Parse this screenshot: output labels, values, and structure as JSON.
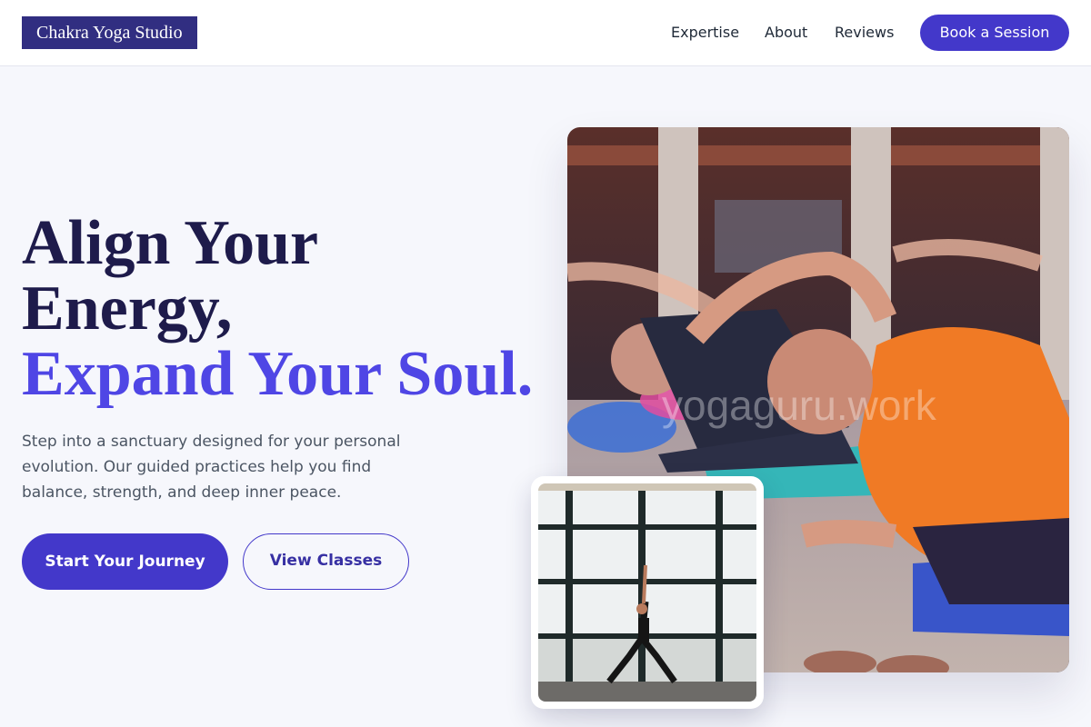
{
  "brand": {
    "name": "Chakra Yoga Studio"
  },
  "nav": {
    "links": [
      "Expertise",
      "About",
      "Reviews"
    ],
    "cta": "Book a Session"
  },
  "hero": {
    "headline_line1": "Align Your",
    "headline_line2": "Energy,",
    "headline_accent": "Expand Your Soul.",
    "lead": "Step into a sanctuary designed for your personal evolution. Our guided practices help you find balance, strength, and deep inner peace.",
    "primary_cta": "Start Your Journey",
    "secondary_cta": "View Classes"
  },
  "media": {
    "watermark": "yogaguru.work"
  },
  "colors": {
    "brand": "#312e81",
    "accent": "#4338ca",
    "accent_text": "#4f46e5",
    "page_bg": "#f6f7fc"
  }
}
